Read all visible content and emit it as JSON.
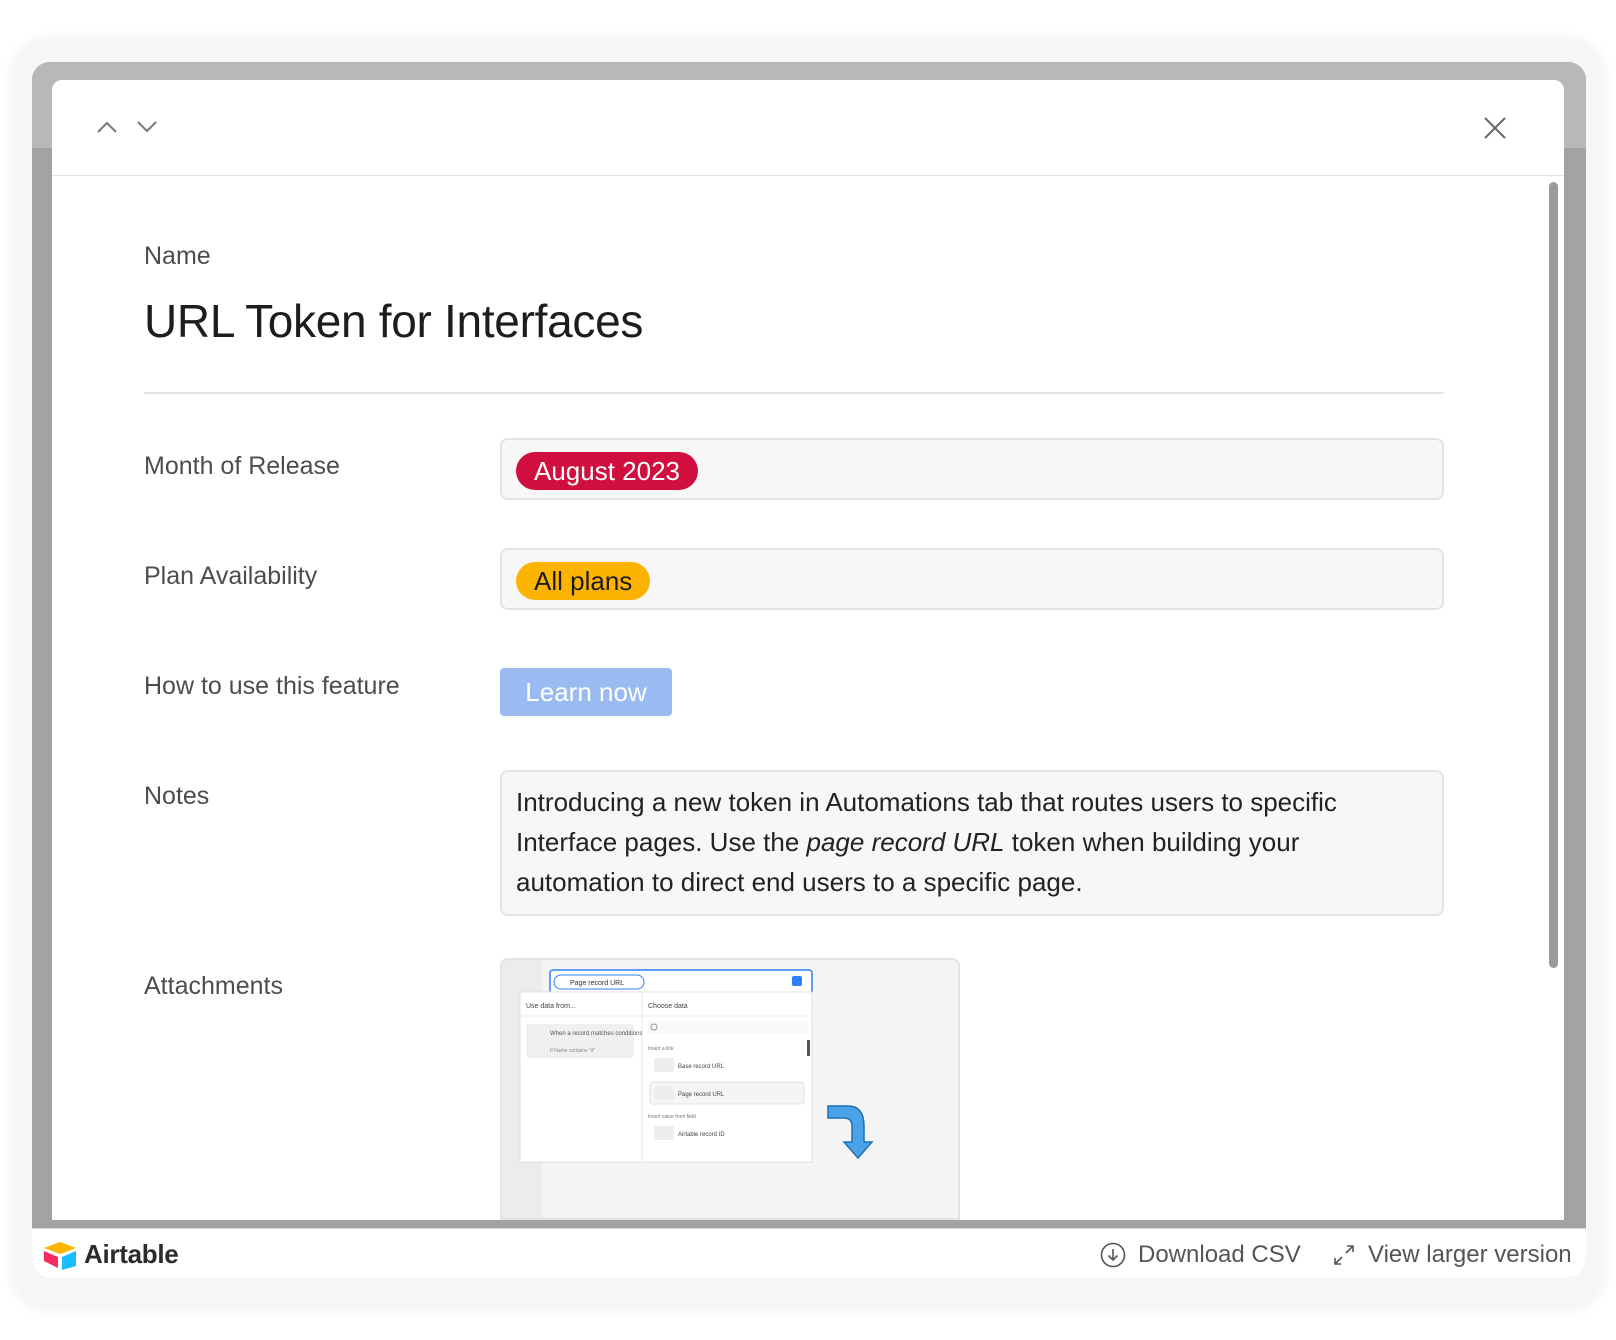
{
  "record": {
    "name_label": "Name",
    "title": "URL Token for Interfaces"
  },
  "fields": {
    "month": {
      "label": "Month of Release",
      "value": "August 2023",
      "color": "#d10f3f"
    },
    "plan": {
      "label": "Plan Availability",
      "value": "All plans",
      "color": "#fcb400"
    },
    "howto": {
      "label": "How to use this feature",
      "button_label": "Learn now",
      "color": "#99bbf2"
    },
    "notes": {
      "label": "Notes",
      "text_before": "Introducing a new token in Automations tab that routes users to specific Interface pages. Use the ",
      "text_emphasis": "page record URL",
      "text_after": " token when building your automation to direct end users to a specific page."
    },
    "attachments": {
      "label": "Attachments",
      "thumb": {
        "token_chip": "Page record URL",
        "use_data_from": "Use data from...",
        "choose_data": "Choose data",
        "trigger_title": "When a record matches conditions",
        "trigger_sub": "If Name contains \"d\"",
        "insert_link": "Insert a link",
        "base_record_url": "Base record URL",
        "page_record_url": "Page record URL",
        "insert_value": "Insert value from field",
        "airtable_record_id": "Airtable record ID"
      }
    }
  },
  "footer": {
    "brand": "Airtable",
    "download_label": "Download CSV",
    "view_larger_label": "View larger version"
  },
  "icons": {
    "nav_up": "chevron-up-icon",
    "nav_down": "chevron-down-icon",
    "close": "close-icon",
    "download": "download-icon",
    "expand": "expand-icon",
    "logo": "airtable-logo-icon"
  },
  "colors": {
    "arrow_blue": "#4aa3e8"
  }
}
